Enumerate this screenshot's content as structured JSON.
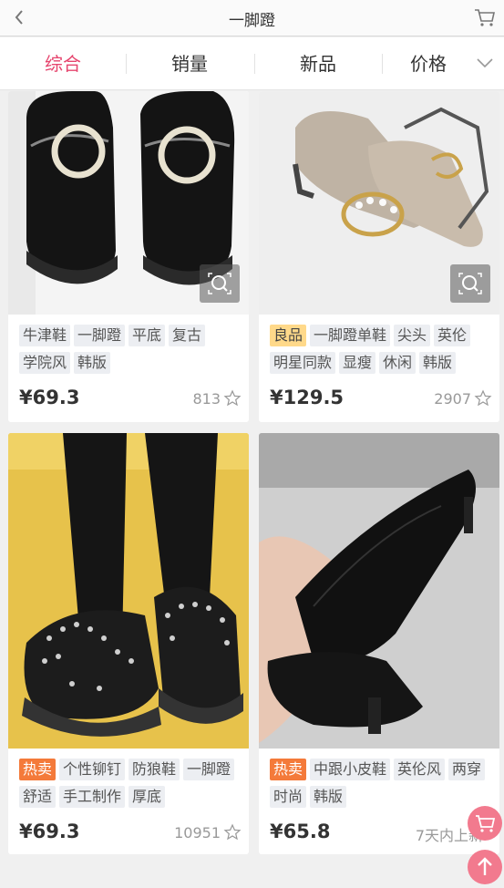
{
  "header": {
    "title": "一脚蹬",
    "back_icon": "chevron-left-icon",
    "cart_icon": "cart-icon"
  },
  "sort_tabs": [
    {
      "label": "综合"
    },
    {
      "label": "销量"
    },
    {
      "label": "新品"
    },
    {
      "label": "价格"
    }
  ],
  "products": [
    {
      "tags": [
        "牛津鞋",
        "一脚蹬",
        "平底",
        "复古",
        "学院风",
        "韩版"
      ],
      "badge": "",
      "price": "¥69.3",
      "favorites": "813"
    },
    {
      "tags": [
        "一脚蹬单鞋",
        "尖头",
        "英伦",
        "明星同款",
        "显瘦",
        "休闲",
        "韩版"
      ],
      "badge": "良品",
      "price": "¥129.5",
      "favorites": "2907"
    },
    {
      "tags": [
        "个性铆钉",
        "防狼鞋",
        "一脚蹬",
        "舒适",
        "手工制作",
        "厚底"
      ],
      "badge": "热卖",
      "price": "¥69.3",
      "favorites": "10951"
    },
    {
      "tags": [
        "中跟小皮鞋",
        "英伦风",
        "两穿",
        "时尚",
        "韩版"
      ],
      "badge": "热卖",
      "price": "¥65.8",
      "favorites": "7天内上新"
    }
  ],
  "colors": {
    "accent": "#e6456e",
    "hot_badge": "#f47a3a",
    "good_badge": "#ffd98a"
  }
}
